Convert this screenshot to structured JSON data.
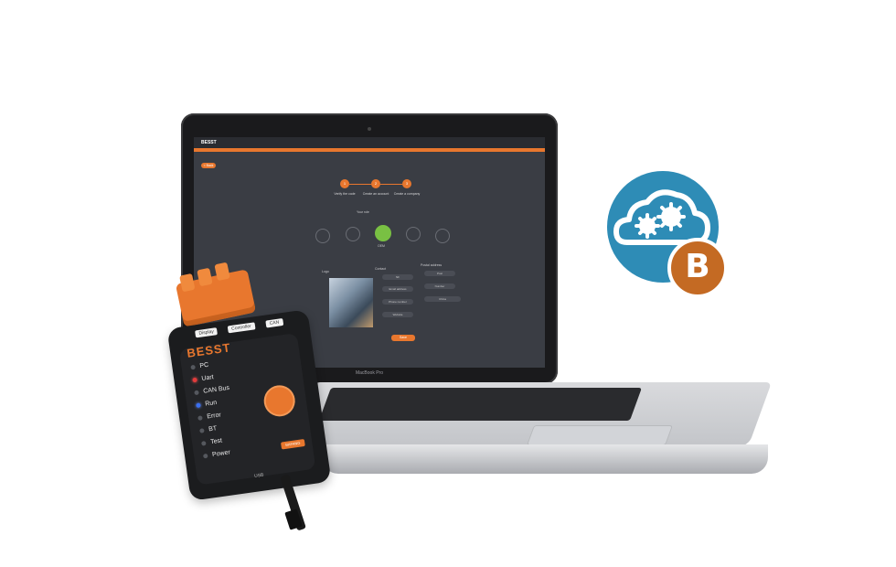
{
  "screen_app": {
    "title": "BESST",
    "back_label": "< Back",
    "steps": [
      "1",
      "2",
      "3"
    ],
    "step_labels": [
      "Verify the code",
      "Create an account",
      "Create a company"
    ],
    "roles_heading": "Your role",
    "selected_role": "OEM",
    "logo_label": "Logo",
    "contact_label": "Contact",
    "postal_label": "Postal address",
    "fields_left": [
      "NF",
      "Email address",
      "Phone number",
      "Website"
    ],
    "fields_right": [
      "Post",
      "Number",
      "China"
    ],
    "submit_label": "Save"
  },
  "laptop_label": "MacBook Pro",
  "device": {
    "tabs": [
      "Display",
      "Controller",
      "CAN"
    ],
    "brand": "BESST",
    "leds": [
      {
        "label": "PC",
        "state": "off"
      },
      {
        "label": "Uart",
        "state": "red"
      },
      {
        "label": "CAN Bus",
        "state": "off"
      },
      {
        "label": "Run",
        "state": "blue"
      },
      {
        "label": "Error",
        "state": "off"
      },
      {
        "label": "BT",
        "state": "off"
      },
      {
        "label": "Test",
        "state": "off"
      },
      {
        "label": "Power",
        "state": "off"
      }
    ],
    "badge": "BAFANG",
    "port_label": "USB"
  },
  "cloud_logo": {
    "letter": "B",
    "colors": {
      "circle": "#2e8cb6",
      "badge": "#c46a23"
    }
  }
}
